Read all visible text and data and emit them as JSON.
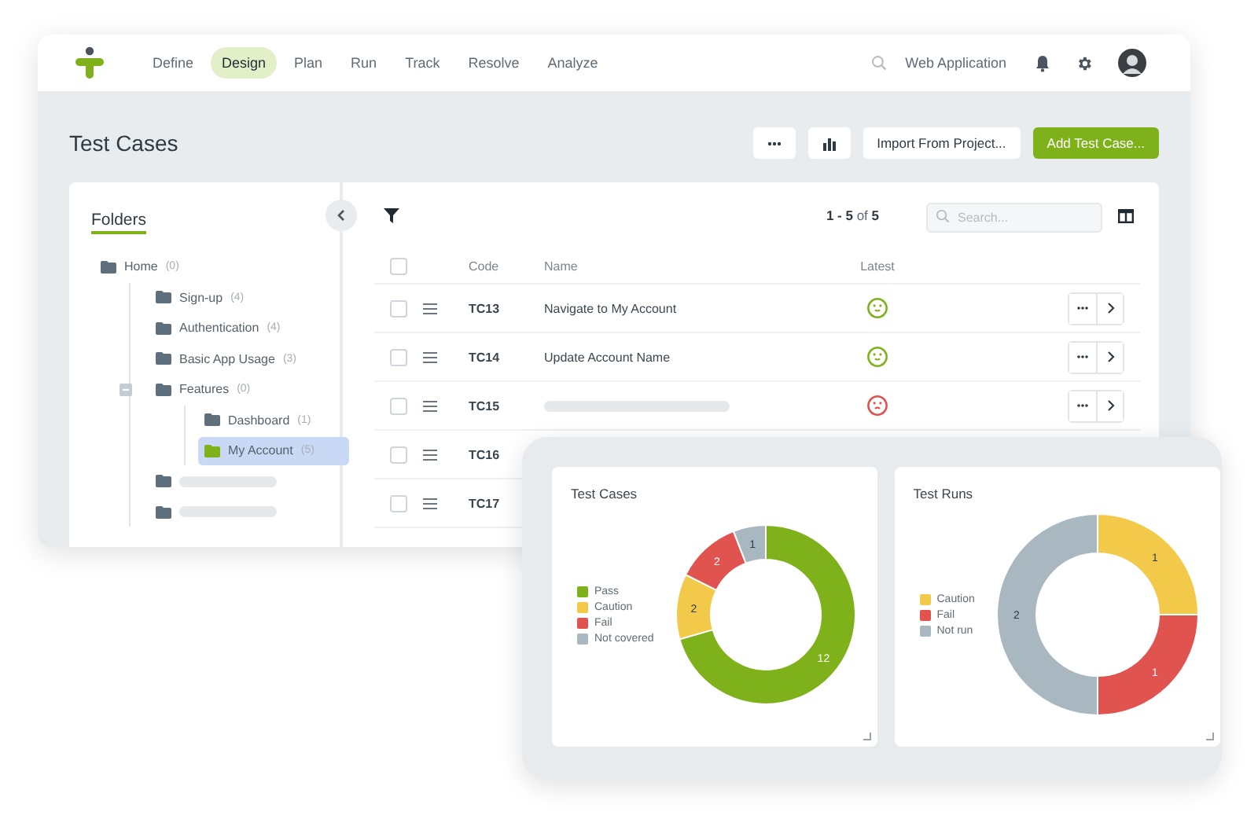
{
  "nav": {
    "items": [
      {
        "label": "Define",
        "selected": false
      },
      {
        "label": "Design",
        "selected": true
      },
      {
        "label": "Plan",
        "selected": false
      },
      {
        "label": "Run",
        "selected": false
      },
      {
        "label": "Track",
        "selected": false
      },
      {
        "label": "Resolve",
        "selected": false
      },
      {
        "label": "Analyze",
        "selected": false
      }
    ],
    "project": "Web Application"
  },
  "page": {
    "title": "Test Cases",
    "buttons": [
      {
        "kind": "more"
      },
      {
        "kind": "chart"
      },
      {
        "kind": "text",
        "label": "Import From Project..."
      },
      {
        "kind": "primary",
        "label": "Add Test Case..."
      }
    ]
  },
  "folders": {
    "title": "Folders",
    "items": [
      {
        "label": "Home",
        "count": "(0)",
        "selected": false,
        "children": [
          {
            "label": "Sign-up",
            "count": "(4)",
            "selected": false
          },
          {
            "label": "Authentication",
            "count": "(4)",
            "selected": false
          },
          {
            "label": "Basic App Usage",
            "count": "(3)",
            "selected": false
          },
          {
            "label": "Features",
            "count": "(0)",
            "selected": false,
            "expanded": true,
            "children": [
              {
                "label": "Dashboard",
                "count": "(1)",
                "selected": false
              },
              {
                "label": "My Account",
                "count": "(5)",
                "selected": true
              }
            ]
          },
          {
            "kind": "placeholder"
          },
          {
            "kind": "placeholder"
          }
        ]
      }
    ]
  },
  "table": {
    "all_checked": false,
    "pagination": "**1 - 5** of **5**",
    "search": {
      "placeholder": "Search..."
    },
    "columns": [
      "Code",
      "Name",
      "Latest"
    ],
    "rows": [
      {
        "checked": false,
        "code": "TC13",
        "name": "Navigate to My Account",
        "passed": true
      },
      {
        "checked": false,
        "code": "TC14",
        "name": "Update Account Name",
        "passed": true
      },
      {
        "checked": false,
        "code": "TC15",
        "passed": false
      },
      {
        "checked": false,
        "code": "TC16"
      },
      {
        "checked": false,
        "code": "TC17"
      }
    ]
  },
  "charts": [
    {
      "title": "Test Cases",
      "chart_data": {
        "type": "donut",
        "categories": [
          "Pass",
          "Caution",
          "Fail",
          "Not covered"
        ],
        "values": [
          12,
          2,
          2,
          1
        ],
        "colors": [
          "#7fb11a",
          "#f3c94a",
          "#e0534e",
          "#a9b7c0"
        ],
        "data_labels": true
      }
    },
    {
      "title": "Test Runs",
      "chart_data": {
        "type": "donut",
        "categories": [
          "Caution",
          "Fail",
          "Not run"
        ],
        "values": [
          1,
          1,
          2
        ],
        "colors": [
          "#f3c94a",
          "#e0534e",
          "#a9b7c0"
        ],
        "data_labels": true
      }
    }
  ]
}
